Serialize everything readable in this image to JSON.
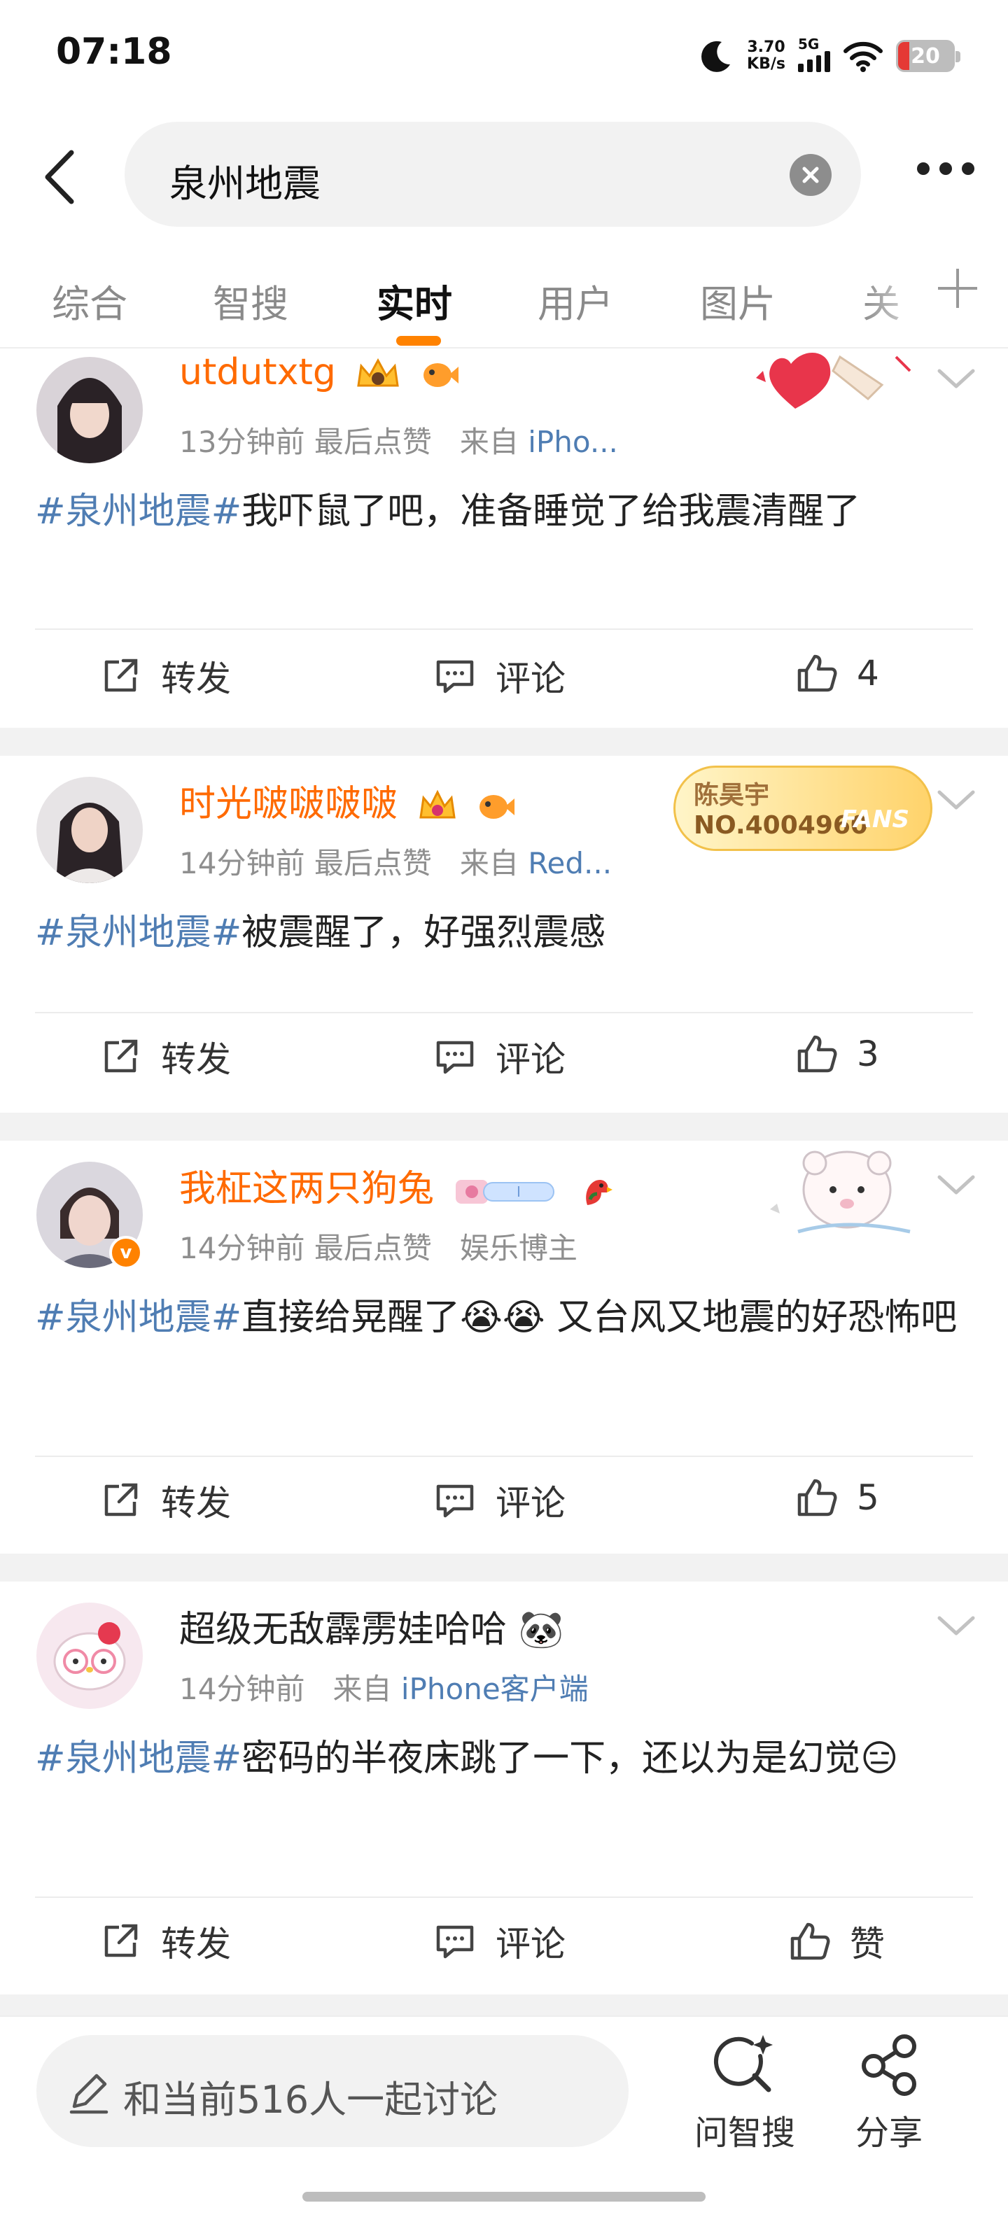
{
  "status_bar": {
    "time": "07:18",
    "net_speed_value": "3.70",
    "net_speed_unit": "KB/s",
    "network": "5G",
    "battery": "20"
  },
  "search": {
    "query": "泉州地震"
  },
  "tabs": [
    "综合",
    "智搜",
    "实时",
    "用户",
    "图片",
    "关"
  ],
  "active_tab_index": 2,
  "posts": [
    {
      "username": "utdutxtg",
      "time": "13分钟前",
      "extra": "最后点赞",
      "source_label": "来自",
      "source": "iPho...",
      "hashtag": "#泉州地震#",
      "text": "我吓鼠了吧，准备睡觉了给我震清醒了",
      "repost_label": "转发",
      "comment_label": "评论",
      "like_label": "4"
    },
    {
      "username": "时光啵啵啵啵",
      "time": "14分钟前",
      "extra": "最后点赞",
      "source_label": "来自",
      "source": "Red...",
      "fan_badge_name": "陈昊宇",
      "fan_badge_no": "NO.4004960",
      "fan_badge_tag": "FANS",
      "hashtag": "#泉州地震#",
      "text": "被震醒了，好强烈震感",
      "repost_label": "转发",
      "comment_label": "评论",
      "like_label": "3"
    },
    {
      "username": "我柾这两只狗兔",
      "time": "14分钟前",
      "extra": "最后点赞",
      "source": "娱乐博主",
      "verified_mark": "v",
      "hashtag": "#泉州地震#",
      "text": "直接给晃醒了😭😭 又台风又地震的好恐怖吧",
      "repost_label": "转发",
      "comment_label": "评论",
      "like_label": "5"
    },
    {
      "username": "超级无敌霹雳娃哈哈",
      "username_emoji": "🐼",
      "time": "14分钟前",
      "source_label": "来自",
      "source": "iPhone客户端",
      "hashtag": "#泉州地震#",
      "text": "密码的半夜床跳了一下，还以为是幻觉😑",
      "repost_label": "转发",
      "comment_label": "评论",
      "like_label": "赞"
    }
  ],
  "bottom_bar": {
    "discuss_placeholder": "和当前516人一起讨论",
    "ask_label": "问智搜",
    "share_label": "分享"
  },
  "colors": {
    "accent": "#ff8200",
    "username": "#ff6a00",
    "link": "#4f7db3",
    "separator": "#f2f2f2"
  },
  "icons": [
    "moon-icon",
    "wifi-icon",
    "battery-icon",
    "back-arrow-icon",
    "clear-icon",
    "more-icon",
    "chevron-down-icon",
    "repost-icon",
    "comment-icon",
    "like-icon",
    "pencil-icon",
    "ai-search-icon",
    "share-icon"
  ]
}
